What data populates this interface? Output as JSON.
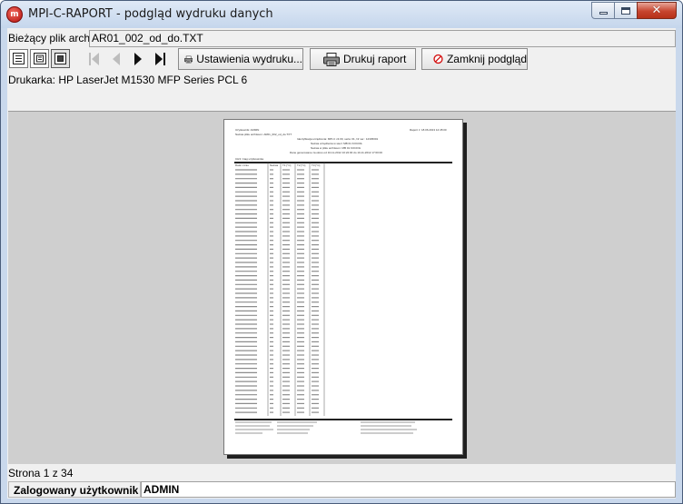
{
  "window": {
    "title": "MPI-C-RAPORT - podgląd wydruku danych",
    "app_icon_glyph": "m",
    "controls": {
      "minimize": "minimize-icon",
      "maximize": "maximize-icon",
      "close": "close-icon",
      "close_glyph": "✕"
    }
  },
  "file": {
    "label": "Bieżący plik archiwun",
    "value": "AR01_002_od_do.TXT"
  },
  "toolbar": {
    "view_icons": [
      "view-list-icon",
      "view-fit-page-icon",
      "view-single-page-icon"
    ],
    "nav_icons": [
      "first-page-icon",
      "previous-page-icon",
      "next-page-icon",
      "last-page-icon"
    ],
    "print_settings_label": "Ustawienia wydruku...",
    "print_report_label": "Drukuj raport",
    "close_preview_label": "Zamknij podgląd"
  },
  "printer": {
    "text": "Drukarka: HP LaserJet M1530 MFP Series PCL 6"
  },
  "page_preview": {
    "header_user": "Użytkownik: ADMIN",
    "header_date": "Raport z: 18.06.2013 12:45:00",
    "file_line": "Nazwa pliku archiwum: AR01_002_od_do.TXT",
    "center_lines": [
      "Identyfikacja urządzenia: MPI-C v3.00, seria: 01, Nr ser.: 12345001",
      "Nazwa urządzenia w sieci: MB 01 KOCIOŁ",
      "Nazwa w pliku archiwum: MB 01 KOCIOŁ",
      "Dane generowane za okres od 10-11-2012 10:22:00 do 10-11-2012 17:00:00"
    ],
    "section_title": "CH3: Ciąg użytkownika",
    "columns": [
      "Data i czas",
      "Nazwa",
      "T1 [°C]",
      "T2 [°C]",
      "T3 [°C]"
    ],
    "row_count": 56
  },
  "status": {
    "page_text": "Strona 1 z 34"
  },
  "user": {
    "label": "Zalogowany użytkownik",
    "value": "ADMIN"
  },
  "colors": {
    "titlebar": "#c9d8ec",
    "client_bg": "#f0f0f0",
    "preview_bg": "#cfcfcf",
    "close_button": "#c7452f"
  }
}
